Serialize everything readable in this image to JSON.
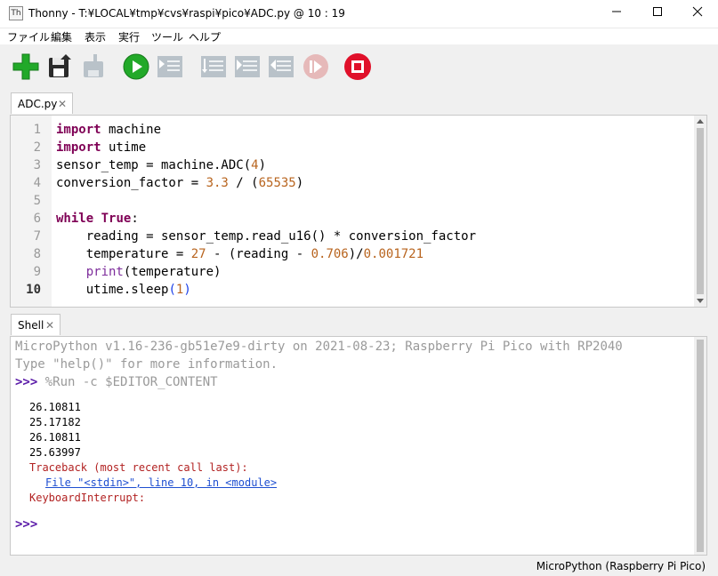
{
  "window": {
    "title": "Thonny  -  T:¥LOCAL¥tmp¥cvs¥raspi¥pico¥ADC.py  @  10 : 19",
    "app_icon_glyph": "Th"
  },
  "menu": [
    "ファイル",
    "編集",
    "表示",
    "実行",
    "ツール",
    "ヘルプ"
  ],
  "toolbar": {
    "new": "new-file",
    "save": "save",
    "load": "load-disabled",
    "run": "run",
    "debug": "debug-disabled",
    "step_over": "step-over-disabled",
    "step_into": "step-into-disabled",
    "step_out": "step-out-disabled",
    "resume": "resume-disabled",
    "stop": "stop",
    "colors": {
      "green": "#22a929",
      "stop": "#e0102a",
      "disabled": "#b9c2c9"
    }
  },
  "editor": {
    "tab_label": "ADC.py",
    "line_numbers": [
      "1",
      "2",
      "3",
      "4",
      "5",
      "6",
      "7",
      "8",
      "9",
      "10"
    ],
    "current_line": "10"
  },
  "code": {
    "l1_kw": "import",
    "l1_rest": " machine",
    "l2_kw": "import",
    "l2_rest": " utime",
    "l3_a": "sensor_temp = machine.ADC(",
    "l3_n": "4",
    "l3_b": ")",
    "l4_a": "conversion_factor = ",
    "l4_n1": "3.3",
    "l4_b": " / (",
    "l4_n2": "65535",
    "l4_c": ")",
    "l6_kw1": "while",
    "l6_sp": " ",
    "l6_kw2": "True",
    "l6_c": ":",
    "l7": "    reading = sensor_temp.read_u16() * conversion_factor",
    "l8_a": "    temperature = ",
    "l8_n1": "27",
    "l8_b": " - (reading - ",
    "l8_n2": "0.706",
    "l8_c": ")/",
    "l8_n3": "0.001721",
    "l9_ind": "    ",
    "l9_bi": "print",
    "l9_rest": "(temperature)",
    "l10_a": "    utime.sleep",
    "l10_p1": "(",
    "l10_n": "1",
    "l10_p2": ")"
  },
  "shell": {
    "tab_label": "Shell",
    "banner1": "MicroPython v1.16-236-gb51e7e9-dirty on 2021-08-23; Raspberry Pi Pico with RP2040",
    "banner2": "Type \"help()\" for more information.",
    "prompt": ">>>",
    "run_cmd": " %Run -c $EDITOR_CONTENT",
    "outputs": [
      "26.10811",
      "25.17182",
      "26.10811",
      "25.63997"
    ],
    "traceback": "Traceback (most recent call last):",
    "file_link": "File \"<stdin>\", line 10, in <module>",
    "error": "KeyboardInterrupt:",
    "final_prompt": ">>>"
  },
  "status": {
    "interpreter": "MicroPython (Raspberry Pi Pico)"
  }
}
